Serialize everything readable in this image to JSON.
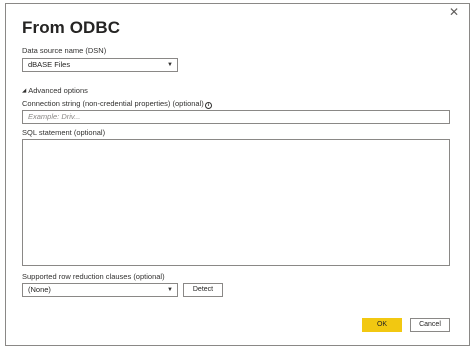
{
  "dialog": {
    "title": "From ODBC",
    "close_glyph": "✕"
  },
  "dsn": {
    "label": "Data source name (DSN)",
    "value": "dBASE Files"
  },
  "advanced": {
    "toggle_label": "Advanced options",
    "connection_label": "Connection string (non-credential properties) (optional)",
    "connection_placeholder": "Example: Driv...",
    "sql_label": "SQL statement (optional)"
  },
  "row_reduction": {
    "label": "Supported row reduction clauses (optional)",
    "value": "(None)",
    "detect_label": "Detect"
  },
  "footer": {
    "ok_label": "OK",
    "cancel_label": "Cancel"
  },
  "colors": {
    "accent": "#f2c811",
    "border": "#8a8886"
  }
}
